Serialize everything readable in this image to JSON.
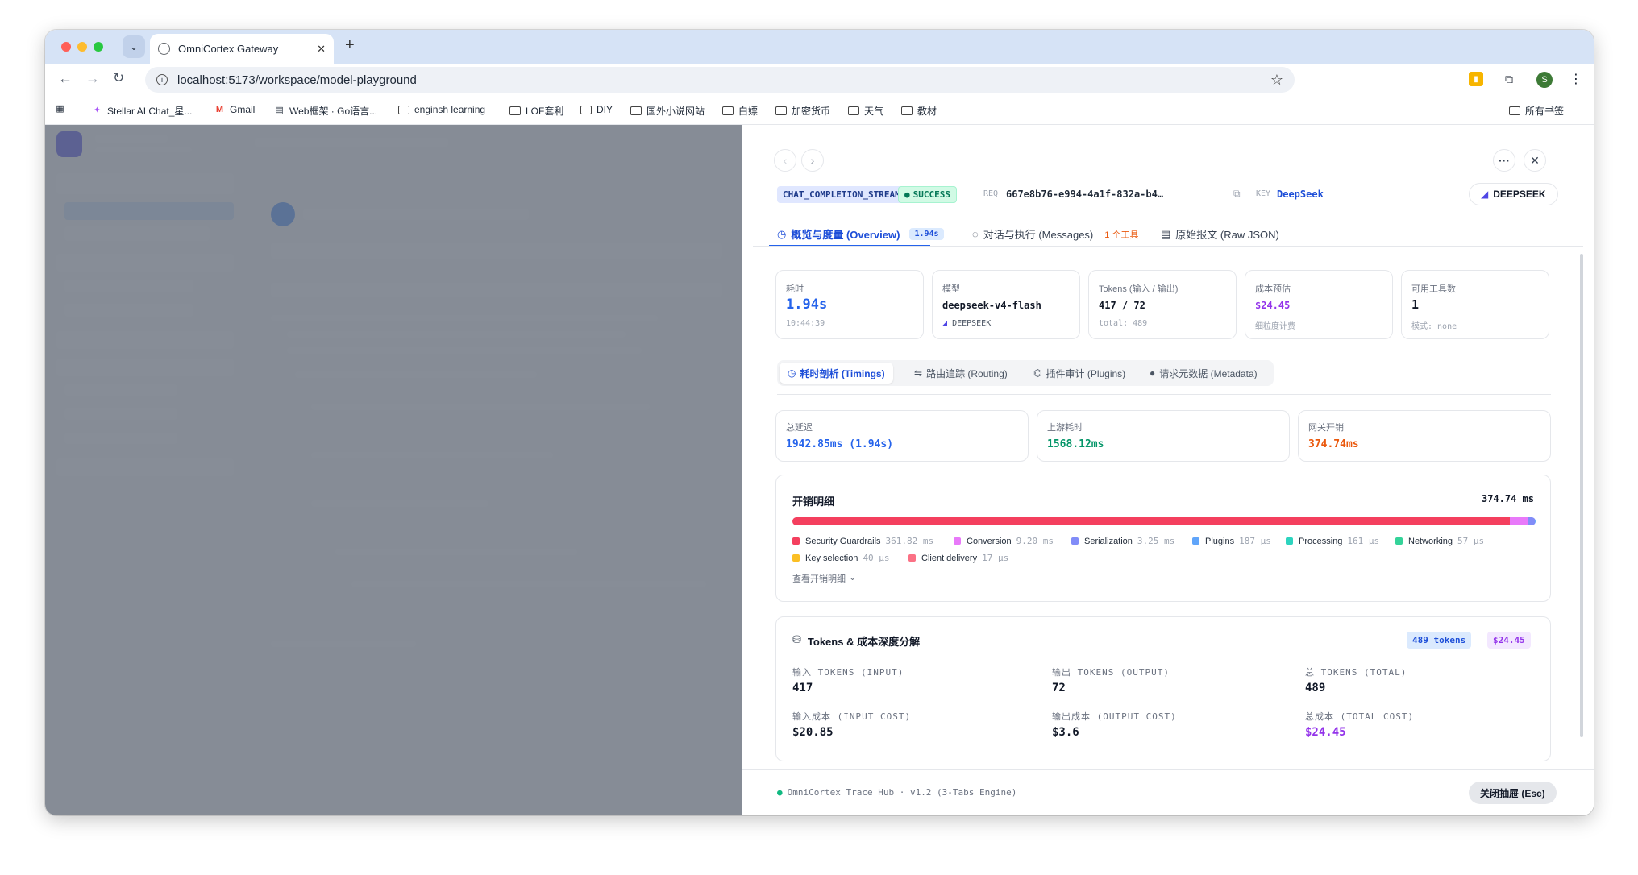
{
  "browser": {
    "tab_title": "OmniCortex Gateway",
    "url": "localhost:5173/workspace/model-playground",
    "avatar_letter": "S",
    "bookmarks": [
      "Stellar AI Chat_星...",
      "Gmail",
      "Web框架 · Go语言...",
      "enginsh learning",
      "LOF套利",
      "DIY",
      "国外小说网站",
      "白嫖",
      "加密货币",
      "天气",
      "教材"
    ],
    "all_bookmarks": "所有书签"
  },
  "drawer": {
    "type_badge": "CHAT_COMPLETION_STREAM",
    "status_badge": "SUCCESS",
    "req_label": "REQ",
    "req_id": "667e8b76-e994-4a1f-832a-b4…",
    "key_label": "KEY",
    "key_value": "DeepSeek",
    "provider_button": "DEEPSEEK",
    "tabs": [
      {
        "label": "概览与度量 (Overview)",
        "badge": "1.94s"
      },
      {
        "label": "对话与执行 (Messages)",
        "badge": "1 个工具"
      },
      {
        "label": "原始报文 (Raw JSON)",
        "badge": ""
      }
    ],
    "stats": [
      {
        "label": "耗时",
        "value": "1.94s",
        "sub": "10:44:39"
      },
      {
        "label": "模型",
        "value": "deepseek-v4-flash",
        "sub": "DEEPSEEK"
      },
      {
        "label": "Tokens (输入 / 输出)",
        "value": "417 / 72",
        "sub": "total: 489"
      },
      {
        "label": "成本预估",
        "value": "$24.45",
        "sub": "细粒度计费"
      },
      {
        "label": "可用工具数",
        "value": "1",
        "sub": "模式: none"
      }
    ],
    "subtabs": [
      "耗时剖析 (Timings)",
      "路由追踪 (Routing)",
      "插件审计 (Plugins)",
      "请求元数据 (Metadata)"
    ],
    "latency": [
      {
        "label": "总延迟",
        "value": "1942.85ms (1.94s)"
      },
      {
        "label": "上游耗时",
        "value": "1568.12ms"
      },
      {
        "label": "网关开销",
        "value": "374.74ms"
      }
    ],
    "overhead": {
      "title": "开销明细",
      "total": "374.74 ms",
      "items": [
        {
          "name": "Security Guardrails",
          "value": "361.82 ms",
          "color": "#f43f5e",
          "share": 0.9655
        },
        {
          "name": "Conversion",
          "value": "9.20 ms",
          "color": "#e879f9",
          "share": 0.0246
        },
        {
          "name": "Serialization",
          "value": "3.25 ms",
          "color": "#818cf8",
          "share": 0.0087
        },
        {
          "name": "Plugins",
          "value": "187 μs",
          "color": "#60a5fa",
          "share": 0.0005
        },
        {
          "name": "Processing",
          "value": "161 μs",
          "color": "#2dd4bf",
          "share": 0.0004
        },
        {
          "name": "Networking",
          "value": "57 μs",
          "color": "#34d399",
          "share": 0.0002
        },
        {
          "name": "Key selection",
          "value": "40 μs",
          "color": "#fbbf24",
          "share": 0.0001
        },
        {
          "name": "Client delivery",
          "value": "17 μs",
          "color": "#fb7185",
          "share": 0.0001
        }
      ],
      "expand": "查看开销明细"
    },
    "tokens": {
      "title": "Tokens & 成本深度分解",
      "tokens_badge": "489 tokens",
      "cost_badge": "$24.45",
      "cells": [
        {
          "label": "输入 TOKENS (INPUT)",
          "value": "417"
        },
        {
          "label": "输出 TOKENS (OUTPUT)",
          "value": "72"
        },
        {
          "label": "总 TOKENS (TOTAL)",
          "value": "489"
        },
        {
          "label": "输入成本 (INPUT COST)",
          "value": "$20.85"
        },
        {
          "label": "输出成本 (OUTPUT COST)",
          "value": "$3.6"
        },
        {
          "label": "总成本 (TOTAL COST)",
          "value": "$24.45"
        }
      ]
    },
    "footer_text": "OmniCortex Trace Hub · v1.2 (3-Tabs Engine)",
    "close_button": "关闭抽屉 (Esc)"
  },
  "colors": {
    "blue": "#2563eb",
    "green": "#059669",
    "orange": "#ea580c",
    "purple": "#9333ea"
  }
}
